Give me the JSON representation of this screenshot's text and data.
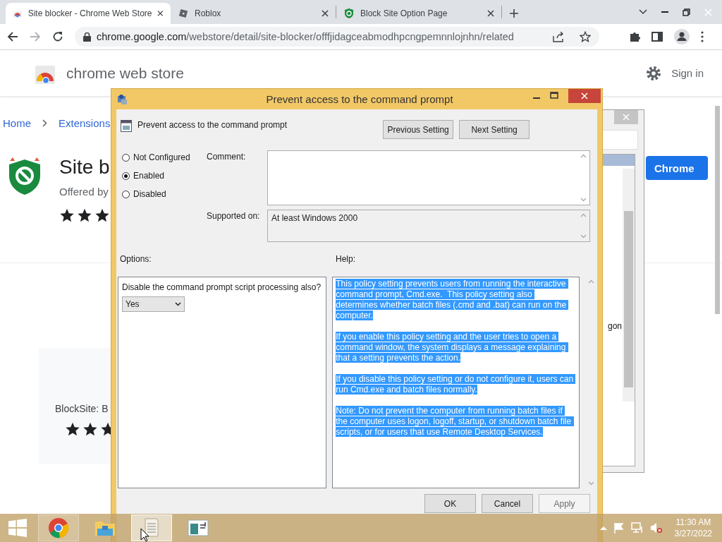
{
  "browser": {
    "tabs": [
      {
        "title": "Site blocker - Chrome Web Store",
        "kind": "store",
        "selected": true
      },
      {
        "title": "Roblox",
        "kind": "roblox",
        "selected": false
      },
      {
        "title": "Block Site Option Page",
        "kind": "shield",
        "selected": false
      }
    ],
    "url_host": "chrome.google.com",
    "url_path": "/webstore/detail/site-blocker/offfjidagceabmodhpcngpemnnlojnhn/related"
  },
  "store": {
    "title": "chrome web store",
    "sign_in": "Sign in",
    "breadcrumbs": [
      "Home",
      "Extensions"
    ],
    "extension": {
      "name": "Site b",
      "offered_by": "Offered by",
      "stars": 3,
      "add_button": "Chrome"
    },
    "related": [
      {
        "name": "BlockSite: B",
        "stars": 3
      }
    ]
  },
  "background_window": {
    "text": "gon"
  },
  "dialog": {
    "title": "Prevent access to the command prompt",
    "setting_name": "Prevent access to the command prompt",
    "nav_buttons": [
      "Previous Setting",
      "Next Setting"
    ],
    "states": [
      {
        "label": "Not Configured",
        "selected": false
      },
      {
        "label": "Enabled",
        "selected": true
      },
      {
        "label": "Disabled",
        "selected": false
      }
    ],
    "comment_label": "Comment:",
    "supported_label": "Supported on:",
    "supported": "At least Windows 2000",
    "options_label": "Options:",
    "help_label": "Help:",
    "options": [
      {
        "label": "Disable the command prompt script processing also?",
        "value": "Yes"
      }
    ],
    "help": {
      "selected": true,
      "paragraphs": [
        "This policy setting prevents users from running the interactive command prompt, Cmd.exe.  This policy setting also determines whether batch files (.cmd and .bat) can run on the computer.",
        "If you enable this policy setting and the user tries to open a command window, the system displays a message explaining that a setting prevents the action.",
        "If you disable this policy setting or do not configure it, users can run Cmd.exe and batch files normally.",
        "Note: Do not prevent the computer from running batch files if the computer uses logon, logoff, startup, or shutdown batch file scripts, or for users that use Remote Desktop Services."
      ]
    },
    "buttons": [
      {
        "label": "OK",
        "disabled": false
      },
      {
        "label": "Cancel",
        "disabled": false
      },
      {
        "label": "Apply",
        "disabled": true
      }
    ]
  },
  "taskbar": {
    "apps": [
      {
        "kind": "chrome",
        "selected": false,
        "running": true
      },
      {
        "kind": "explorer",
        "selected": false,
        "running": false
      },
      {
        "kind": "notepad",
        "selected": true,
        "running": true
      },
      {
        "kind": "window",
        "selected": false,
        "running": false
      }
    ],
    "time": "11:30 AM",
    "date": "3/27/2022"
  }
}
